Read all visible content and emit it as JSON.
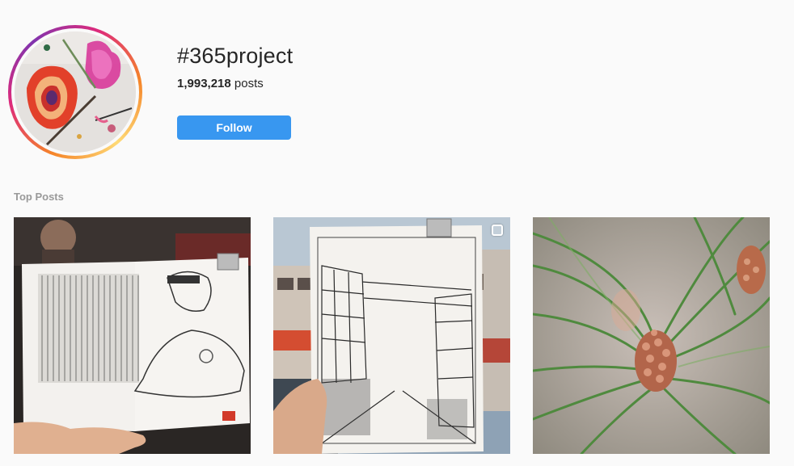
{
  "hashtag": {
    "title": "#365project",
    "count": "1,993,218",
    "count_label": "posts"
  },
  "follow_label": "Follow",
  "top_posts_label": "Top Posts",
  "colors": {
    "accent": "#3897f0",
    "background": "#fafafa",
    "muted_text": "#999999"
  },
  "posts": [
    {
      "icon": null
    },
    {
      "icon": "multiple-images-icon"
    },
    {
      "icon": null
    }
  ]
}
